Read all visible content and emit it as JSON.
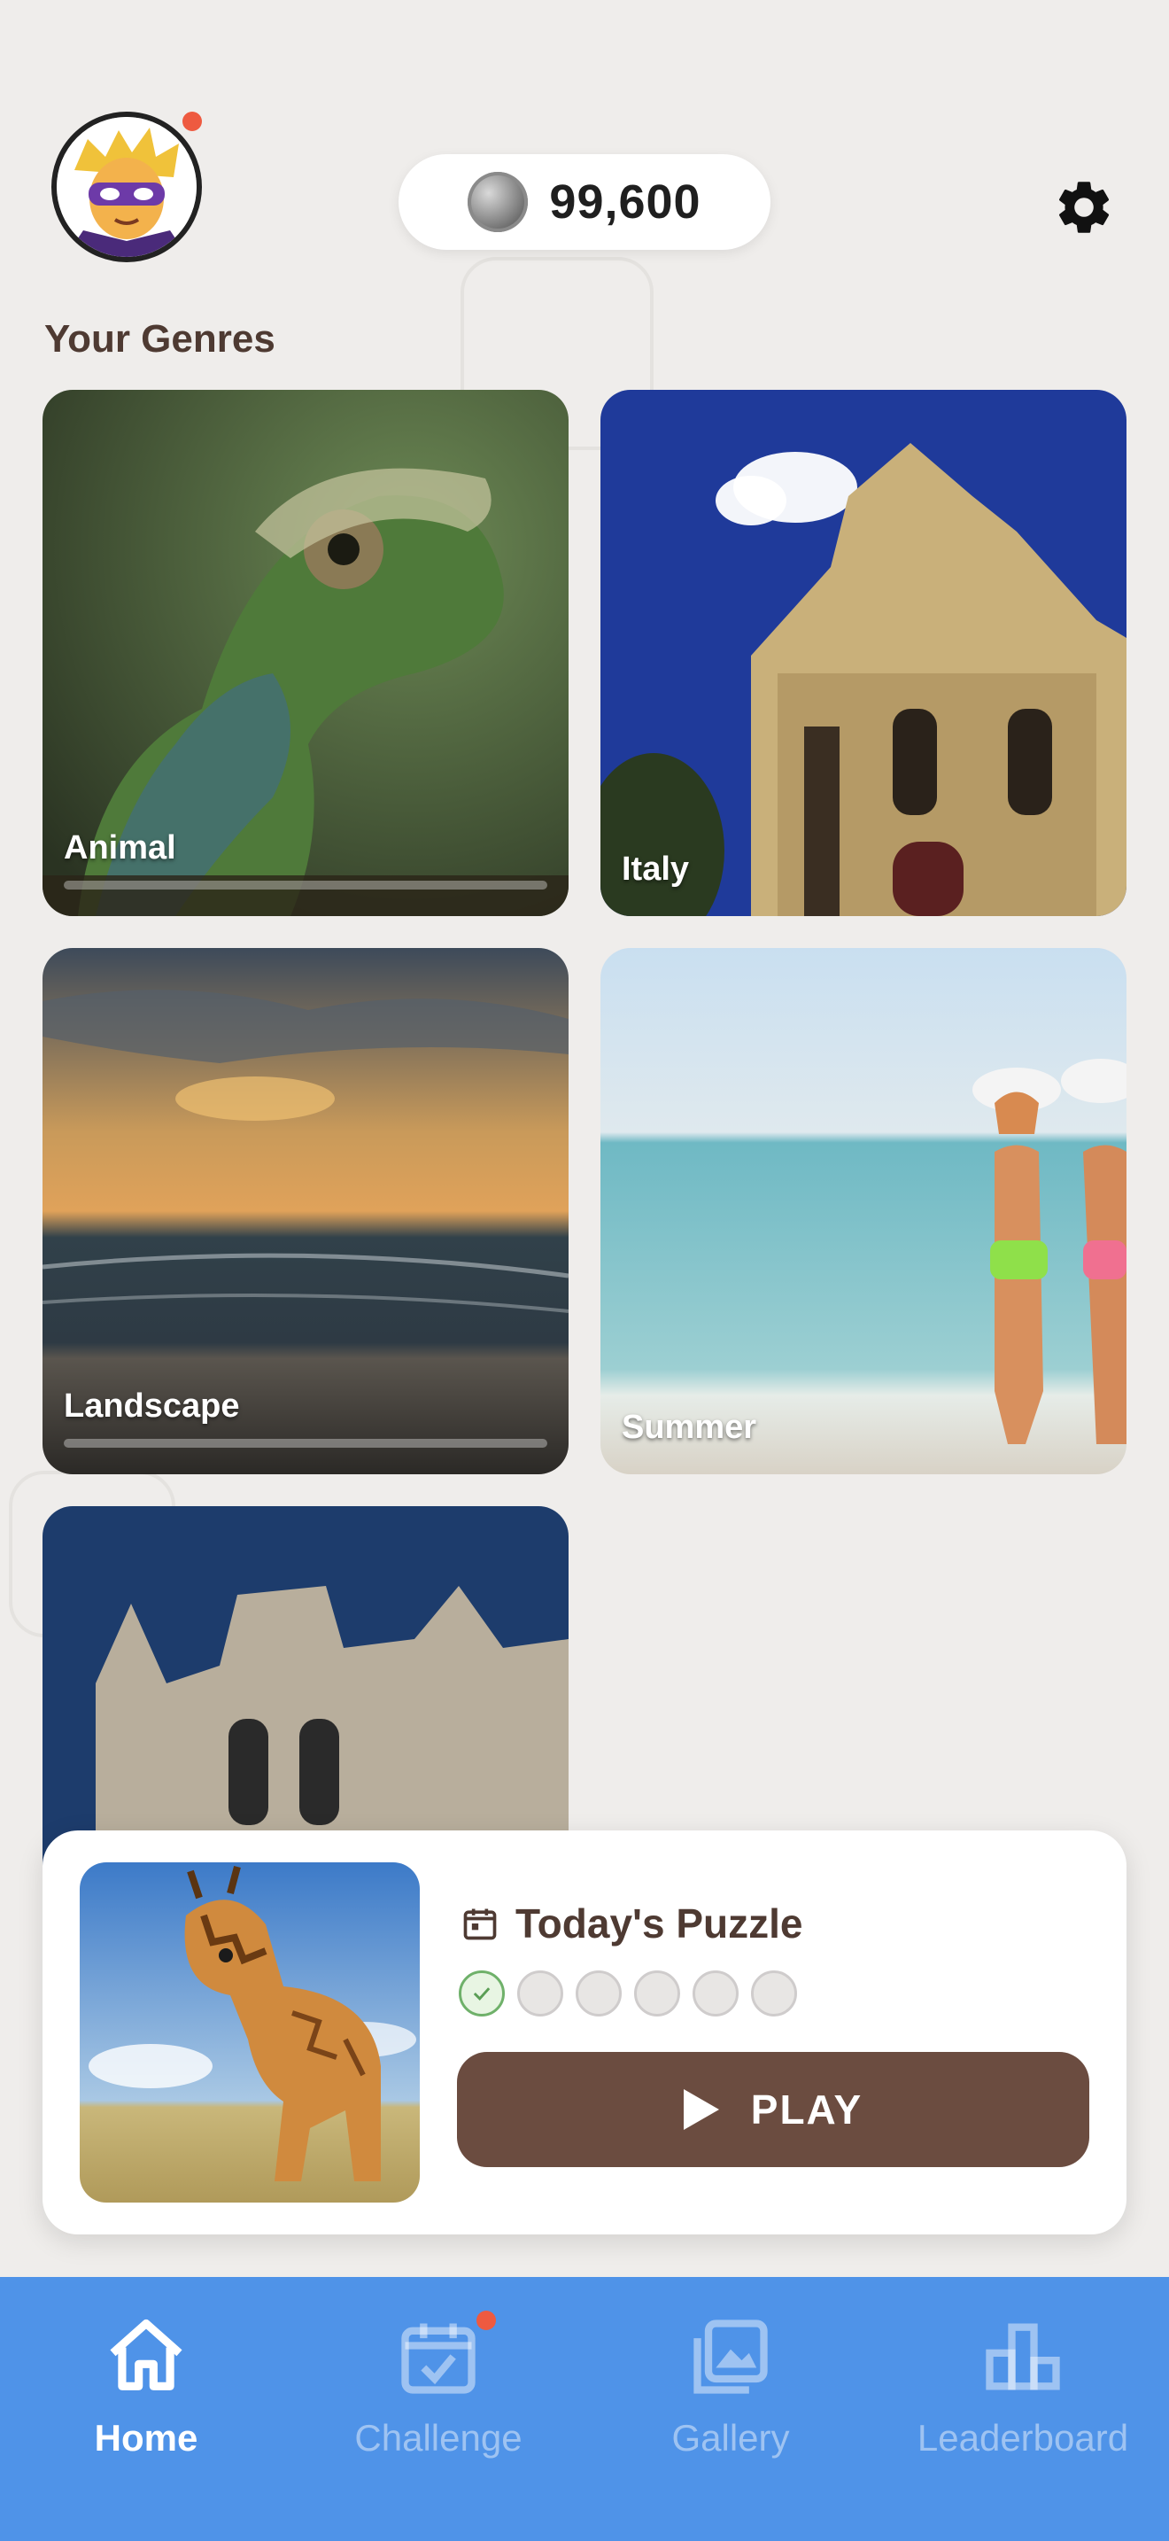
{
  "header": {
    "coin_balance": "99,600",
    "avatar_has_notification": true
  },
  "genres": {
    "title": "Your Genres",
    "items": [
      {
        "label": "Animal",
        "progress": 0.0
      },
      {
        "label": "Italy",
        "progress": null
      },
      {
        "label": "Landscape",
        "progress": 0.0
      },
      {
        "label": "Summer",
        "progress": null
      },
      {
        "label": "",
        "progress": null
      }
    ]
  },
  "todays_puzzle": {
    "title": "Today's Puzzle",
    "completed_days": 1,
    "total_days": 6,
    "play_label": "PLAY"
  },
  "nav": {
    "items": [
      {
        "label": "Home",
        "icon": "home-icon",
        "active": true
      },
      {
        "label": "Challenge",
        "icon": "calendar-check-icon",
        "active": false,
        "badge": true
      },
      {
        "label": "Gallery",
        "icon": "gallery-icon",
        "active": false
      },
      {
        "label": "Leaderboard",
        "icon": "leaderboard-icon",
        "active": false
      }
    ]
  },
  "colors": {
    "background": "#efedeb",
    "accent_brown": "#6b4c40",
    "nav_blue": "#4f93e8",
    "badge_red": "#ee5a40"
  }
}
